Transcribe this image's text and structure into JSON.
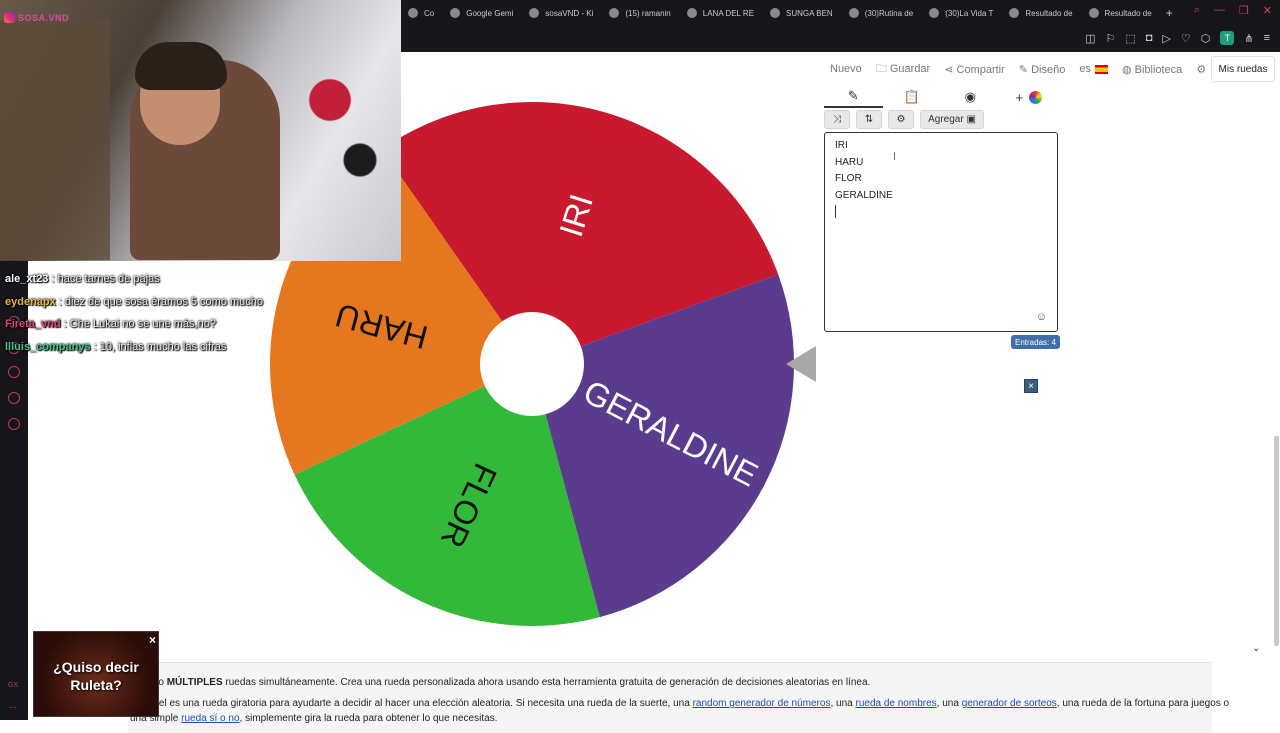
{
  "browser": {
    "tabs": [
      {
        "label": "Co",
        "icon": "generic-tab-icon"
      },
      {
        "label": "Google Gemi",
        "icon": "gemini-icon"
      },
      {
        "label": "sosaVND - Ki",
        "icon": "kick-icon"
      },
      {
        "label": "(15) ramanin",
        "icon": "twitch-icon"
      },
      {
        "label": "LANA DEL RE",
        "icon": "globe-icon"
      },
      {
        "label": "SUNGA BEN",
        "icon": "globe-icon"
      },
      {
        "label": "(30)Rutina de",
        "icon": "tiktok-icon"
      },
      {
        "label": "(30)La Vida T",
        "icon": "tiktok-icon"
      },
      {
        "label": "Resultado de",
        "icon": "google-icon"
      },
      {
        "label": "Resultado de",
        "icon": "google-icon"
      }
    ],
    "new_tab": "+",
    "profile_letter": "T"
  },
  "gx_sidebar": {
    "label": "GX",
    "more": "..."
  },
  "stream": {
    "channel_name": "SOSA.VND",
    "chat": [
      {
        "user": "ale_xt23",
        "user_color": "#ffffff",
        "message": ": hace tarnes de pajas"
      },
      {
        "user": "eydenapx",
        "user_color": "#e8b94a",
        "message": ": diez de que sosa éramos 5 como mucho"
      },
      {
        "user": "Fireta_vnd",
        "user_color": "#e0457b",
        "message": ": Che Lukai no se une más,no?"
      },
      {
        "user": "llluis_companys",
        "user_color": "#4ec48a",
        "message": ": 10, inflas mucho las cifras"
      }
    ]
  },
  "site_nav": {
    "nuevo": "Nuevo",
    "guardar": "Guardar",
    "compartir": "Compartir",
    "diseno": "Diseño",
    "lang": "es",
    "biblioteca": "Biblioteca",
    "mis_ruedas": "Mis ruedas"
  },
  "editor": {
    "agregar": "Agregar",
    "entries": [
      "IRI",
      "HARU",
      "FLOR",
      "GERALDINE"
    ],
    "count_label": "Entradas: 4",
    "close": "×"
  },
  "wheel": {
    "segments": [
      {
        "label": "IRI",
        "color": "#c8192e"
      },
      {
        "label": "GERALDINE",
        "color": "#5a3b8e"
      },
      {
        "label": "FLOR",
        "color": "#33b93a"
      },
      {
        "label": "HARU",
        "color": "#e5781f"
      }
    ]
  },
  "ad": {
    "text_line1": "¿Quiso decir",
    "text_line2": "Ruleta?",
    "close": "×"
  },
  "info": {
    "line1_pre": "rueda o ",
    "line1_bold": "MÚLTIPLES",
    "line1_post": " ruedas simultáneamente. Crea una rueda personalizada ahora usando esta herramienta gratuita de generación de decisiones aleatorias en línea.",
    "line2_pre": "e Wheel es una rueda giratoria para ayudarte a decidir al hacer una elección aleatoria. Si necesita una rueda de la suerte, una ",
    "line2_link1": "random generador de números",
    "line2_mid1": ", una ",
    "line2_link2": "rueda de nombres",
    "line2_mid2": ", una ",
    "line2_link3": "generador de sorteos",
    "line2_post": ", una rueda de la fortuna para juegos o",
    "line3_pre": "una simple ",
    "line3_link": "rueda sí o no",
    "line3_post": ", simplemente gira la rueda para obtener lo que necesitas."
  }
}
